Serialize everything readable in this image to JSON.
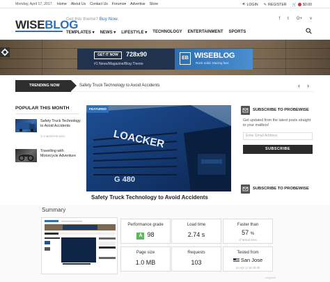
{
  "topbar": {
    "date": "Monday, April 17, 2017",
    "links": [
      "Home",
      "About Us",
      "Contact Us",
      "Forums",
      "Advertise",
      "Store"
    ],
    "login": "LOGIN",
    "register": "REGISTER",
    "cart": "$0.00"
  },
  "header": {
    "logo_a": "WISE",
    "logo_b": "BLOG",
    "tagline": "Get this theme?",
    "tagline_link": "Buy Now.",
    "nav": [
      "TEMPLATES",
      "NEWS",
      "LIFESTYLE",
      "TECHNOLOGY",
      "ENTERTAINMENT",
      "SPORTS"
    ],
    "nav_dropdown": [
      "TEMPLATES",
      "NEWS",
      "LIFESTYLE"
    ],
    "social": [
      "f",
      "t",
      "G+",
      "v"
    ]
  },
  "ad": {
    "cta": "GET IT NOW",
    "size": "728x90",
    "subtitle": "#1 News/Magazine/Blog Theme",
    "badge": "EB",
    "brand": "WISEBLOG",
    "brand_sub": "Rock Solid. Mazing fast."
  },
  "trending": {
    "label": "TRENDING NOW",
    "headline": "Safety Truck Technology to Avoid Accidents"
  },
  "popular": {
    "title": "POPULAR THIS MONTH",
    "items": [
      {
        "title": "Safety Truck Technology to Avoid Accidents",
        "date": "6 MONTHS AGO"
      },
      {
        "title": "Travelling with Motorcycle Adventure",
        "date": "6 MONTHS AGO"
      }
    ]
  },
  "featured": {
    "badge": "FEATURED",
    "title": "Safety Truck Technology to Avoid Accidents",
    "truck_text": "LOACKER",
    "plate": "G 480"
  },
  "subscribe": {
    "title": "SUBSCRIBE TO PROBEWISE",
    "text": "Get updated from the latest posts straight to your mailbox!",
    "placeholder": "Enter Email Address",
    "button": "SUBSCRIBE",
    "title2": "SUBSCRIBE TO PROBEWISE"
  },
  "summary": {
    "title": "Summary",
    "cards": {
      "grade_label": "Performance grade",
      "grade_letter": "A",
      "grade_value": "98",
      "load_label": "Load time",
      "load_value": "2.74 s",
      "faster_label": "Faster than",
      "faster_value": "57",
      "faster_unit": "%",
      "faster_small": "of tested sites",
      "size_label": "Page size",
      "size_value": "1.0 MB",
      "requests_label": "Requests",
      "requests_value": "103",
      "tested_label": "Tested from",
      "tested_value": "San Jose",
      "tested_small": "on Apr 17 at 09:45"
    },
    "watermark": "pingdom"
  },
  "colors": {
    "accent": "#2f6fb8",
    "dark": "#2e2e2e",
    "grade_green": "#5cb85c"
  }
}
